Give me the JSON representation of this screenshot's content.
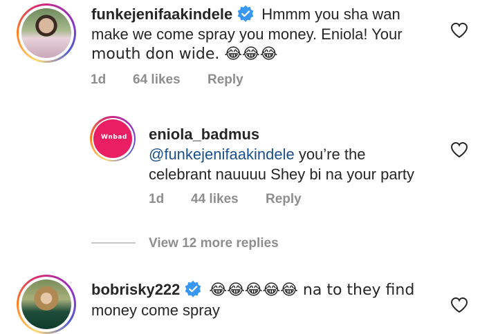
{
  "comments": [
    {
      "username": "funkejenifaakindele",
      "verified": true,
      "text_line1": "Hmmm you sha wan",
      "text_line2": "make we come spray you money. Eniola! Your",
      "text_line3": "mouth don wide. 😂😂😂",
      "time": "1d",
      "likes": "64 likes",
      "reply": "Reply"
    },
    {
      "username": "eniola_badmus",
      "verified": false,
      "mention": "@funkejenifaakindele",
      "text_line1_rest": " you’re the",
      "text_line2": "celebrant nauuuu Shey bi na your party",
      "time": "1d",
      "likes": "44 likes",
      "reply": "Reply",
      "avatar_logo_text": "Wnbad"
    },
    {
      "username": "bobrisky222",
      "verified": true,
      "text_line1": "😂😂😂😂😂 na to they find",
      "text_line2": "money come spray"
    }
  ],
  "view_more_replies": "View 12 more replies",
  "colors": {
    "verified_badge": "#3897f0",
    "mention": "#1a4f8b",
    "meta": "#8e8e8e",
    "avatar2_bg": "#e91e63"
  },
  "icons": [
    "verified-icon",
    "heart-icon"
  ]
}
